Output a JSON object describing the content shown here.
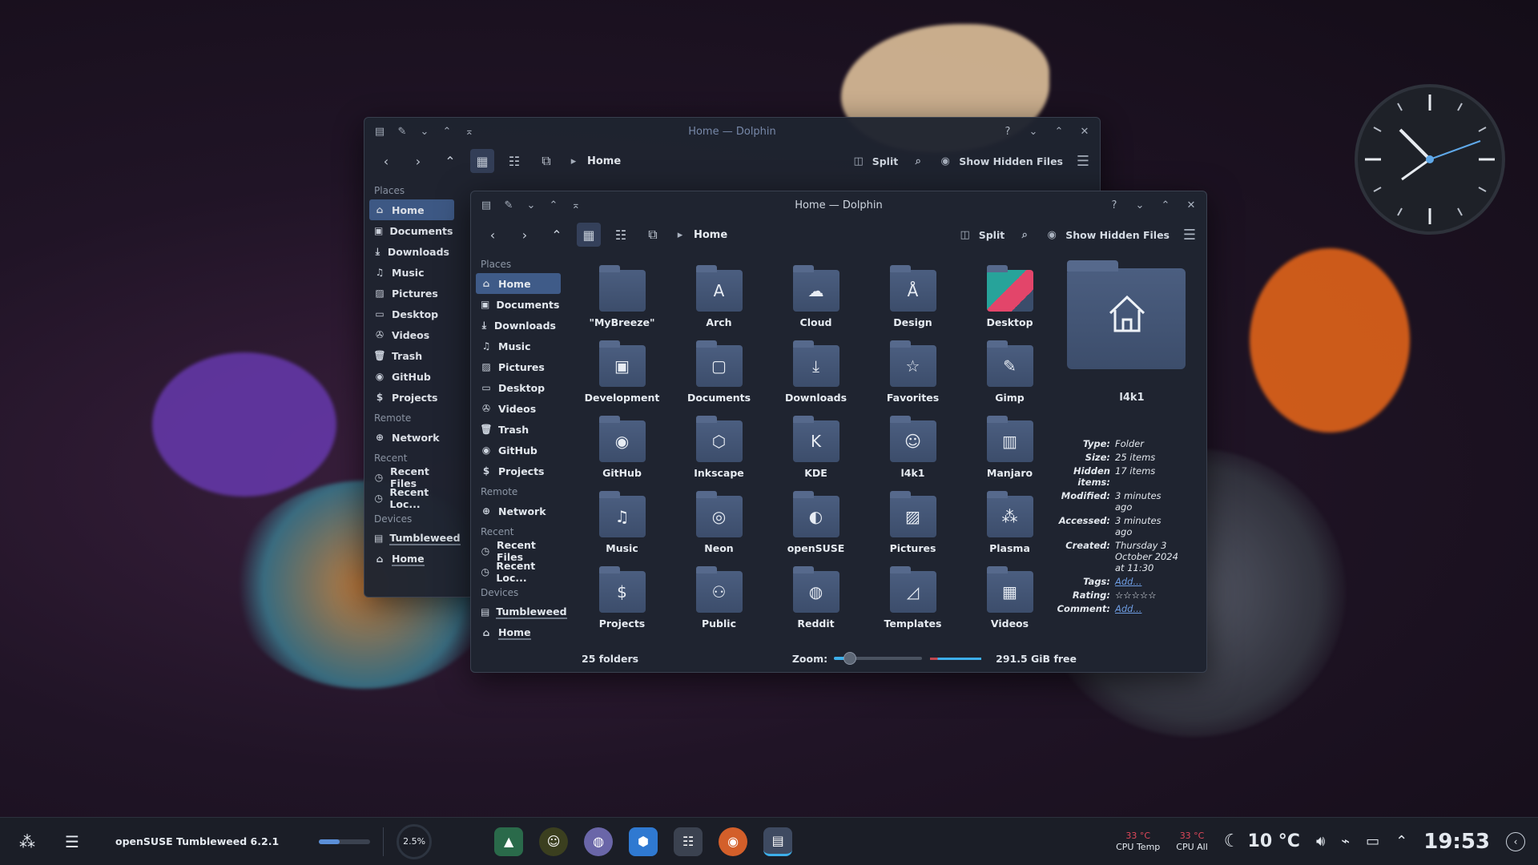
{
  "back_window": {
    "title": "Home — Dolphin",
    "breadcrumb": "Home",
    "split": "Split",
    "show_hidden": "Show Hidden Files",
    "places_header": "Places",
    "places": [
      "Home",
      "Documents",
      "Downloads",
      "Music",
      "Pictures",
      "Desktop",
      "Videos",
      "Trash",
      "GitHub",
      "Projects"
    ],
    "remote_header": "Remote",
    "remote": [
      "Network"
    ],
    "recent_header": "Recent",
    "recent": [
      "Recent Files",
      "Recent Loc..."
    ],
    "devices_header": "Devices",
    "devices": [
      "Tumbleweed",
      "Home"
    ]
  },
  "front_window": {
    "title": "Home — Dolphin",
    "breadcrumb": "Home",
    "split": "Split",
    "show_hidden": "Show Hidden Files",
    "places_header": "Places",
    "places": [
      "Home",
      "Documents",
      "Downloads",
      "Music",
      "Pictures",
      "Desktop",
      "Videos",
      "Trash",
      "GitHub",
      "Projects"
    ],
    "remote_header": "Remote",
    "remote": [
      "Network"
    ],
    "recent_header": "Recent",
    "recent": [
      "Recent Files",
      "Recent Loc..."
    ],
    "devices_header": "Devices",
    "devices": [
      "Tumbleweed",
      "Home"
    ],
    "folders": [
      {
        "label": "\"MyBreeze\"",
        "icon": ""
      },
      {
        "label": "Arch",
        "icon": "A"
      },
      {
        "label": "Cloud",
        "icon": "☁"
      },
      {
        "label": "Design",
        "icon": "Å"
      },
      {
        "label": "Desktop",
        "icon": ""
      },
      {
        "label": "Development",
        "icon": "▣"
      },
      {
        "label": "Documents",
        "icon": "▢"
      },
      {
        "label": "Downloads",
        "icon": "⤓"
      },
      {
        "label": "Favorites",
        "icon": "☆"
      },
      {
        "label": "Gimp",
        "icon": "✎"
      },
      {
        "label": "GitHub",
        "icon": "◉"
      },
      {
        "label": "Inkscape",
        "icon": "⬡"
      },
      {
        "label": "KDE",
        "icon": "K"
      },
      {
        "label": "l4k1",
        "icon": "☺"
      },
      {
        "label": "Manjaro",
        "icon": "▥"
      },
      {
        "label": "Music",
        "icon": "♫"
      },
      {
        "label": "Neon",
        "icon": "◎"
      },
      {
        "label": "openSUSE",
        "icon": "◐"
      },
      {
        "label": "Pictures",
        "icon": "▨"
      },
      {
        "label": "Plasma",
        "icon": "⁂"
      },
      {
        "label": "Projects",
        "icon": "$"
      },
      {
        "label": "Public",
        "icon": "⚇"
      },
      {
        "label": "Reddit",
        "icon": "◍"
      },
      {
        "label": "Templates",
        "icon": "◿"
      },
      {
        "label": "Videos",
        "icon": "▦"
      }
    ],
    "info": {
      "name": "l4k1",
      "rows": [
        {
          "k": "Type:",
          "v": "Folder"
        },
        {
          "k": "Size:",
          "v": "25 items"
        },
        {
          "k": "Hidden items:",
          "v": "17 items"
        },
        {
          "k": "Modified:",
          "v": "3 minutes ago"
        },
        {
          "k": "Accessed:",
          "v": "3 minutes ago"
        },
        {
          "k": "Created:",
          "v": "Thursday 3 October 2024 at 11:30"
        }
      ],
      "tags_k": "Tags:",
      "tags_v": "Add...",
      "rating_k": "Rating:",
      "rating_v": "☆☆☆☆☆",
      "comment_k": "Comment:",
      "comment_v": "Add..."
    },
    "status": {
      "count": "25 folders",
      "zoom_label": "Zoom:",
      "zoom_level": 0.18,
      "free": "291.5 GiB free"
    }
  },
  "taskbar": {
    "os_label": "openSUSE Tumbleweed 6.2.1",
    "cpu_percent": "2.5%",
    "cpu_temp_value": "33 °C",
    "cpu_temp_label": "CPU Temp",
    "cpu_all_value": "33 °C",
    "cpu_all_label": "CPU All",
    "weather": "10 °C",
    "time": "19:53"
  },
  "colors": {
    "accent": "#3f5b88",
    "folder": "#44567a",
    "taskbar": "#1b1e27"
  }
}
